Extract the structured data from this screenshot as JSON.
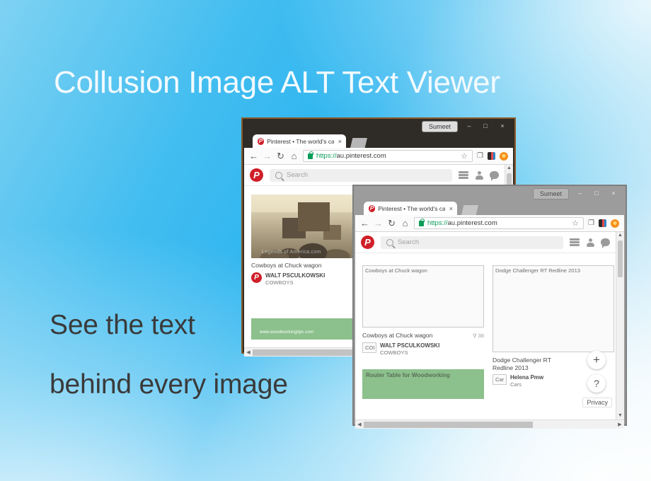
{
  "promo": {
    "title": "Collusion Image ALT Text Viewer",
    "line1": "See the text",
    "line2": "behind every image",
    "title_color": "#f2fafe",
    "body_color": "#3a3a3a",
    "bg_accent": "#2bb4ef"
  },
  "browser": {
    "profile_button": "Sumeet",
    "window_controls": {
      "minimize": "–",
      "maximize": "□",
      "close": "×"
    },
    "tab": {
      "favicon": "pinterest-favicon",
      "title": "Pinterest • The world's cata",
      "close": "×"
    },
    "toolbar": {
      "back": "←",
      "forward": "→",
      "reload": "↻",
      "home": "⌂",
      "url_scheme": "https://",
      "url_host": "au.pinterest.com",
      "lock": "secure-lock-icon",
      "bookmark_star": "☆",
      "cast": "❐",
      "extension_1": "collusion-extension-icon",
      "extension_2": "orange-extension-icon"
    }
  },
  "pinterest": {
    "logo": "P",
    "search_placeholder": "Search",
    "icons": [
      "hamburger-icon",
      "person-icon",
      "chat-icon"
    ]
  },
  "back_window": {
    "pin": {
      "image_caption": "Cowboys at Chuck wagon",
      "author": "WALT PSCULKOWSKI",
      "board": "COWBOYS",
      "photo_watermark": "Legends of America.com"
    },
    "promoted": {
      "watermark": "www.woodworkingtips.com"
    }
  },
  "front_window": {
    "pins": [
      {
        "alt_text": "Cowboys at Chuck wagon",
        "title": "Cowboys at Chuck wagon",
        "count": "36",
        "count_icon": "pin-icon",
        "avatar_alt": "COI",
        "author": "WALT PSCULKOWSKI",
        "board": "COWBOYS"
      },
      {
        "alt_text": "Dodge Challenger RT Redline 2013",
        "title": "Dodge Challenger RT Redline 2013",
        "count": "",
        "avatar_alt": "Car",
        "author": "Helena Pmw",
        "board": "Cars"
      }
    ],
    "promoted_alt": "Router Table for Woodworking",
    "floating": {
      "add": "+",
      "help": "?",
      "privacy": "Privacy"
    }
  }
}
